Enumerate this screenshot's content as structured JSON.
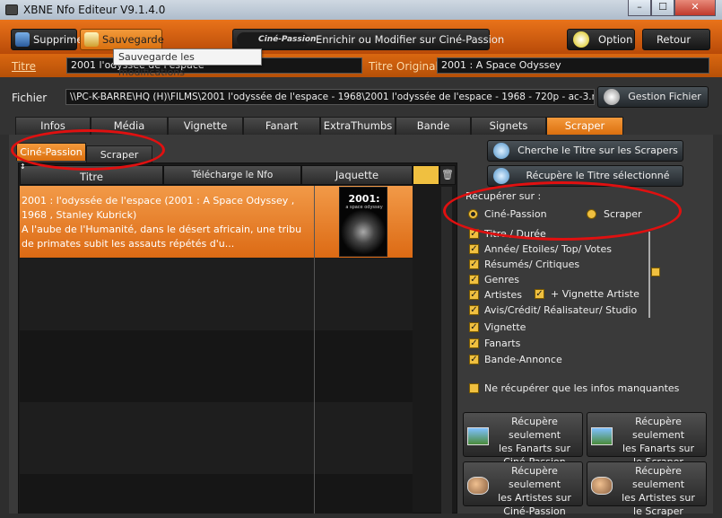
{
  "window": {
    "title": "XBNE Nfo Editeur V9.1.4.0",
    "minimize": "–",
    "maximize": "☐",
    "close": "✕"
  },
  "toolbar": {
    "supprime": "Supprime",
    "sauvegarde": "Sauvegarde",
    "cine_passion_logo": "Ciné-Passion",
    "enrichir": "Enrichir ou Modifier sur Ciné-Passion",
    "option": "Option",
    "retour": "Retour",
    "tooltip": "Sauvegarde les modifications"
  },
  "titre": {
    "label": "Titre",
    "value": "2001 l'odyssée de l'espace",
    "original_label": "Titre Original",
    "original_value": "2001 : A Space Odyssey"
  },
  "fichier": {
    "label": "Fichier",
    "path": "\\\\PC-K-BARRE\\HQ (H)\\FILMS\\2001 l'odyssée de l'espace - 1968\\2001 l'odyssée de l'espace - 1968 - 720p - ac-3.mkv",
    "gestion": "Gestion Fichier"
  },
  "tabs": [
    "Infos",
    "Média",
    "Vignette",
    "Fanart",
    "ExtraThumbs",
    "Bande Annonce",
    "Signets",
    "Scraper"
  ],
  "subtabs": [
    "Ciné-Passion",
    "Scraper"
  ],
  "grid": {
    "col_titre": "Titre",
    "col_telecharge": "Télécharge le Nfo Sélectionné",
    "col_jaquette": "Jaquette",
    "row1_title": "2001 : l'odyssée de l'espace (2001 : A Space Odyssey , 1968 , Stanley Kubrick)",
    "row1_desc": "A l'aube de l'Humanité, dans le désert africain, une tribu de primates subit les assauts répétés d'u...",
    "poster_title": "2001:",
    "poster_sub": "a space odyssey"
  },
  "scraper": {
    "cherche": "Cherche le Titre sur les Scrapers",
    "recupere": "Récupère le Titre sélectionné",
    "recuperer_sur": "Récupérer sur :",
    "radio_cine": "Ciné-Passion",
    "radio_scraper": "Scraper",
    "options": [
      "Titre / Durée",
      "Année/ Etoiles/ Top/ Votes",
      "Résumés/ Critiques",
      "Genres",
      "Artistes",
      "Avis/Crédit/ Réalisateur/ Studio",
      "Vignette",
      "Fanarts",
      "Bande-Annonce"
    ],
    "vignette_artiste": "+ Vignette Artiste",
    "manquantes": "Ne récupérer que les infos manquantes",
    "btn_fanarts_cine": [
      "Récupère seulement",
      "les Fanarts sur",
      "Ciné-Passion"
    ],
    "btn_fanarts_scraper": [
      "Récupère seulement",
      "les Fanarts sur",
      "le Scraper"
    ],
    "btn_artistes_cine": [
      "Récupère seulement",
      "les Artistes sur",
      "Ciné-Passion"
    ],
    "btn_artistes_scraper": [
      "Récupère seulement",
      "les Artistes sur",
      "le Scraper"
    ]
  },
  "colors": {
    "accent": "#e57316",
    "highlight": "#e01010",
    "check": "#f0c040"
  }
}
